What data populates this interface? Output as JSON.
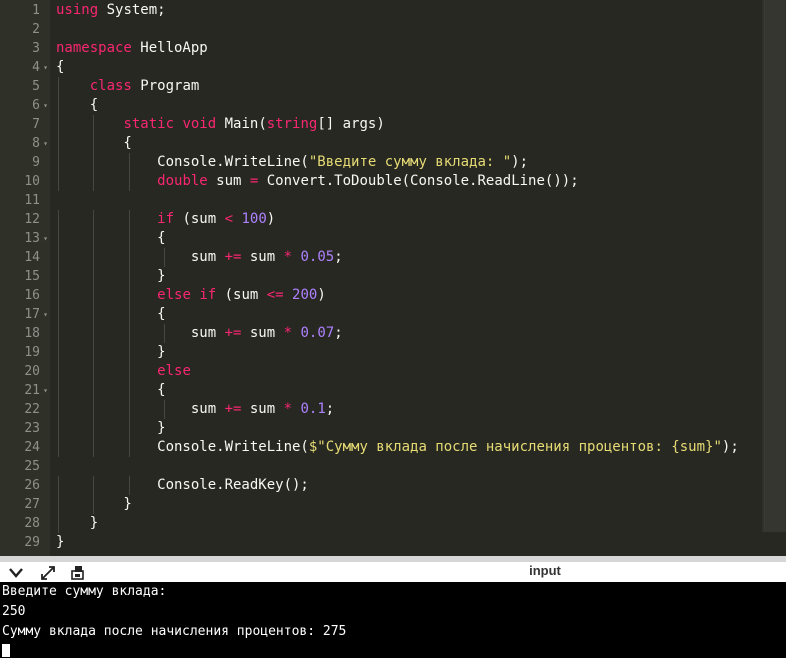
{
  "editor": {
    "lines": [
      {
        "num": "1",
        "fold": "",
        "tokens": [
          [
            "k",
            "using"
          ],
          [
            "w",
            " System;"
          ]
        ]
      },
      {
        "num": "2",
        "fold": "",
        "tokens": []
      },
      {
        "num": "3",
        "fold": "",
        "tokens": [
          [
            "k",
            "namespace"
          ],
          [
            "w",
            " HelloApp"
          ]
        ]
      },
      {
        "num": "4",
        "fold": "▾",
        "tokens": [
          [
            "p",
            "{"
          ]
        ]
      },
      {
        "num": "5",
        "fold": "",
        "tokens": [
          [
            "w",
            "    "
          ],
          [
            "k",
            "class"
          ],
          [
            "w",
            " Program"
          ]
        ]
      },
      {
        "num": "6",
        "fold": "▾",
        "tokens": [
          [
            "w",
            "    {"
          ]
        ]
      },
      {
        "num": "7",
        "fold": "",
        "tokens": [
          [
            "w",
            "        "
          ],
          [
            "k",
            "static"
          ],
          [
            "w",
            " "
          ],
          [
            "k",
            "void"
          ],
          [
            "w",
            " Main("
          ],
          [
            "k",
            "string"
          ],
          [
            "w",
            "[] args)"
          ]
        ]
      },
      {
        "num": "8",
        "fold": "▾",
        "tokens": [
          [
            "w",
            "        {"
          ]
        ]
      },
      {
        "num": "9",
        "fold": "",
        "tokens": [
          [
            "w",
            "            Console.WriteLine("
          ],
          [
            "s",
            "\"Введите сумму вклада: \""
          ],
          [
            "w",
            ");"
          ]
        ]
      },
      {
        "num": "10",
        "fold": "",
        "tokens": [
          [
            "w",
            "            "
          ],
          [
            "k",
            "double"
          ],
          [
            "w",
            " sum "
          ],
          [
            "o",
            "="
          ],
          [
            "w",
            " Convert.ToDouble(Console.ReadLine());"
          ]
        ]
      },
      {
        "num": "11",
        "fold": "",
        "tokens": []
      },
      {
        "num": "12",
        "fold": "",
        "tokens": [
          [
            "w",
            "            "
          ],
          [
            "k",
            "if"
          ],
          [
            "w",
            " (sum "
          ],
          [
            "o",
            "<"
          ],
          [
            "w",
            " "
          ],
          [
            "n",
            "100"
          ],
          [
            "w",
            ")"
          ]
        ]
      },
      {
        "num": "13",
        "fold": "▾",
        "tokens": [
          [
            "w",
            "            {"
          ]
        ]
      },
      {
        "num": "14",
        "fold": "",
        "tokens": [
          [
            "w",
            "                sum "
          ],
          [
            "o",
            "+="
          ],
          [
            "w",
            " sum "
          ],
          [
            "o",
            "*"
          ],
          [
            "w",
            " "
          ],
          [
            "n",
            "0.05"
          ],
          [
            "w",
            ";"
          ]
        ]
      },
      {
        "num": "15",
        "fold": "",
        "tokens": [
          [
            "w",
            "            }"
          ]
        ]
      },
      {
        "num": "16",
        "fold": "",
        "tokens": [
          [
            "w",
            "            "
          ],
          [
            "k",
            "else"
          ],
          [
            "w",
            " "
          ],
          [
            "k",
            "if"
          ],
          [
            "w",
            " (sum "
          ],
          [
            "o",
            "<="
          ],
          [
            "w",
            " "
          ],
          [
            "n",
            "200"
          ],
          [
            "w",
            ")"
          ]
        ]
      },
      {
        "num": "17",
        "fold": "▾",
        "tokens": [
          [
            "w",
            "            {"
          ]
        ]
      },
      {
        "num": "18",
        "fold": "",
        "tokens": [
          [
            "w",
            "                sum "
          ],
          [
            "o",
            "+="
          ],
          [
            "w",
            " sum "
          ],
          [
            "o",
            "*"
          ],
          [
            "w",
            " "
          ],
          [
            "n",
            "0.07"
          ],
          [
            "w",
            ";"
          ]
        ]
      },
      {
        "num": "19",
        "fold": "",
        "tokens": [
          [
            "w",
            "            }"
          ]
        ]
      },
      {
        "num": "20",
        "fold": "",
        "tokens": [
          [
            "w",
            "            "
          ],
          [
            "k",
            "else"
          ]
        ]
      },
      {
        "num": "21",
        "fold": "▾",
        "tokens": [
          [
            "w",
            "            {"
          ]
        ]
      },
      {
        "num": "22",
        "fold": "",
        "tokens": [
          [
            "w",
            "                sum "
          ],
          [
            "o",
            "+="
          ],
          [
            "w",
            " sum "
          ],
          [
            "o",
            "*"
          ],
          [
            "w",
            " "
          ],
          [
            "n",
            "0.1"
          ],
          [
            "w",
            ";"
          ]
        ]
      },
      {
        "num": "23",
        "fold": "",
        "tokens": [
          [
            "w",
            "            }"
          ]
        ]
      },
      {
        "num": "24",
        "fold": "",
        "tokens": [
          [
            "w",
            "            Console.WriteLine("
          ],
          [
            "s",
            "$\"Сумму вклада после начисления процентов: {sum}\""
          ],
          [
            "w",
            ");"
          ]
        ]
      },
      {
        "num": "25",
        "fold": "",
        "tokens": []
      },
      {
        "num": "26",
        "fold": "",
        "tokens": [
          [
            "w",
            "            Console.ReadKey();"
          ]
        ]
      },
      {
        "num": "27",
        "fold": "",
        "tokens": [
          [
            "w",
            "        }"
          ]
        ]
      },
      {
        "num": "28",
        "fold": "",
        "tokens": [
          [
            "w",
            "    }"
          ]
        ]
      },
      {
        "num": "29",
        "fold": "",
        "tokens": [
          [
            "p",
            "}"
          ]
        ]
      }
    ]
  },
  "toolbar": {
    "collapse_icon": "chevron-down-icon",
    "expand_icon": "expand-arrows-icon",
    "copy_icon": "copy-icon",
    "panel_title": "input"
  },
  "console": {
    "lines": [
      "Введите сумму вклада:",
      "250",
      "Сумму вклада после начисления процентов: 275"
    ]
  }
}
